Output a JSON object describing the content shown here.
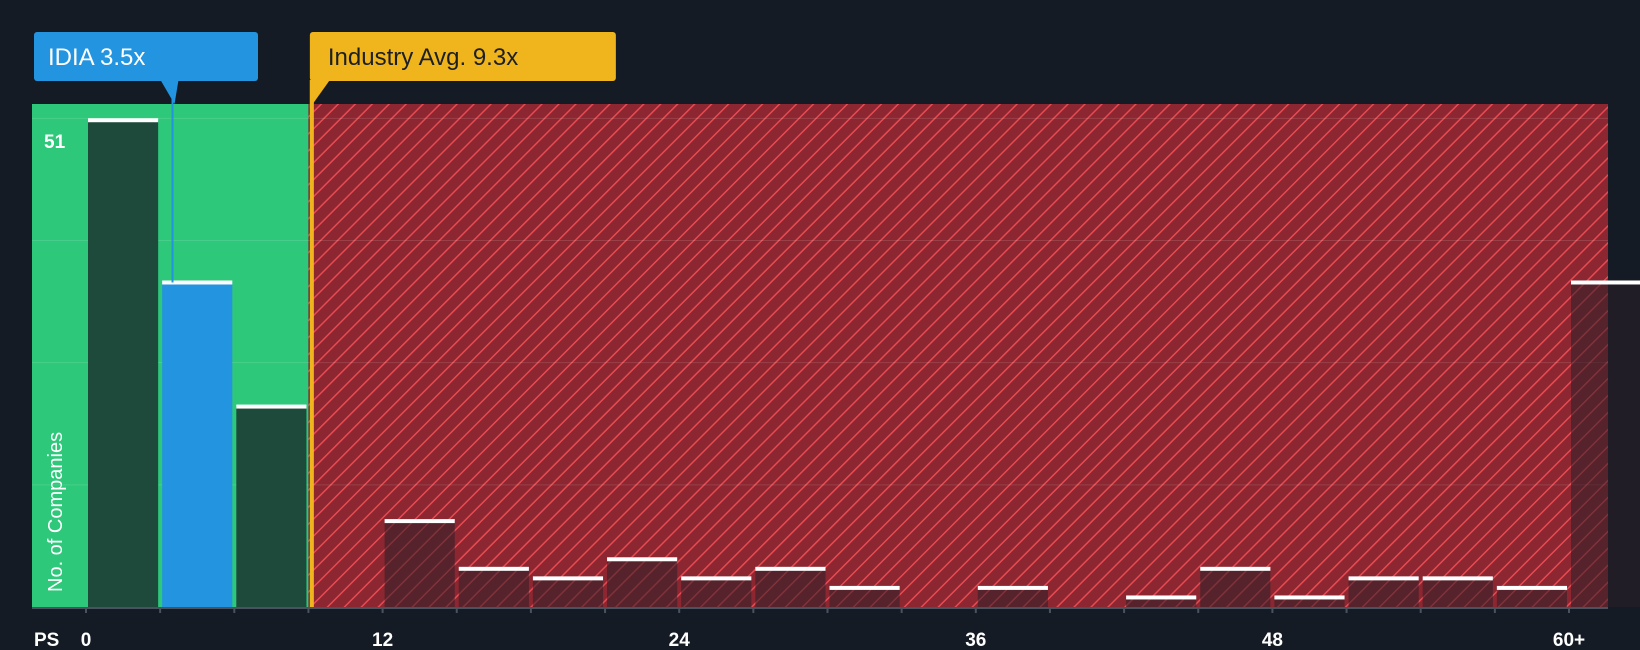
{
  "chart_data": {
    "type": "bar",
    "xlabel": "PS",
    "ylabel": "No. of Companies",
    "x_ticks": [
      {
        "value": 0,
        "label": "0"
      },
      {
        "value": 12,
        "label": "12"
      },
      {
        "value": 24,
        "label": "24"
      },
      {
        "value": 36,
        "label": "36"
      },
      {
        "value": 48,
        "label": "48"
      },
      {
        "value": 60,
        "label": "60+"
      }
    ],
    "xlim": [
      0,
      61.5
    ],
    "ylim": [
      0,
      52.7
    ],
    "y_gridlines": [
      12.8,
      25.6,
      38.4,
      51.2
    ],
    "bin_width": 3,
    "bins": [
      {
        "start": 0,
        "value": 51,
        "label": "51"
      },
      {
        "start": 3,
        "value": 34
      },
      {
        "start": 6,
        "value": 21
      },
      {
        "start": 9,
        "value": 0
      },
      {
        "start": 12,
        "value": 9
      },
      {
        "start": 15,
        "value": 4
      },
      {
        "start": 18,
        "value": 3
      },
      {
        "start": 21,
        "value": 5
      },
      {
        "start": 24,
        "value": 3
      },
      {
        "start": 27,
        "value": 4
      },
      {
        "start": 30,
        "value": 2
      },
      {
        "start": 33,
        "value": 0
      },
      {
        "start": 36,
        "value": 2
      },
      {
        "start": 39,
        "value": 0
      },
      {
        "start": 42,
        "value": 1
      },
      {
        "start": 45,
        "value": 4
      },
      {
        "start": 48,
        "value": 1
      },
      {
        "start": 51,
        "value": 3
      },
      {
        "start": 54,
        "value": 3
      },
      {
        "start": 57,
        "value": 2
      },
      {
        "start": 60,
        "value": 34
      }
    ],
    "company": {
      "label": "IDIA 3.5x",
      "value": 3.5,
      "highlight_bin_start": 3
    },
    "industry_avg": {
      "label": "Industry Avg. 9.3x",
      "value": 9.3
    },
    "colors": {
      "background": "#151b24",
      "fair_zone": "#2ec87a",
      "bar_dark": "#1e4a3c",
      "bar_highlight": "#2394e0",
      "over_zone": "#8c2630",
      "hatch": "#e84a52",
      "company_callout": "#2394e0",
      "industry_callout": "#f0b41c",
      "cap_line": "#ffffff",
      "axis_text": "#ffffff"
    }
  }
}
